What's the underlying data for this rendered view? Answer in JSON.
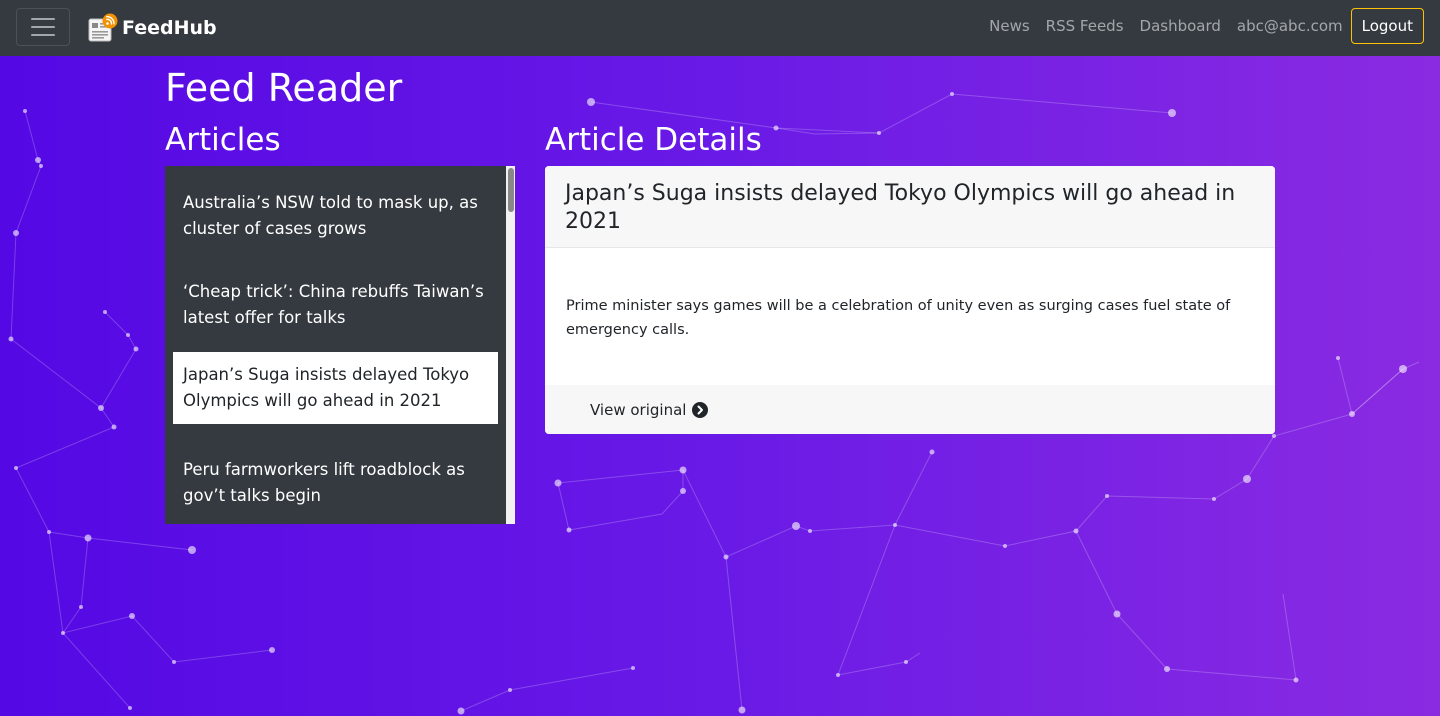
{
  "navbar": {
    "brand": "FeedHub",
    "links": [
      "News",
      "RSS Feeds",
      "Dashboard",
      "abc@abc.com"
    ],
    "logout_label": "Logout",
    "icons": {
      "menu": "hamburger-icon",
      "brand": "rss-newspaper-logo"
    }
  },
  "page": {
    "title": "Feed Reader",
    "articles_heading": "Articles",
    "details_heading": "Article Details"
  },
  "articles": [
    {
      "title": "Australia’s NSW told to mask up, as cluster of cases grows"
    },
    {
      "title": "‘Cheap trick’: China rebuffs Taiwan’s latest offer for talks"
    },
    {
      "title": "Japan’s Suga insists delayed Tokyo Olympics will go ahead in 2021",
      "selected": true
    },
    {
      "title": "Peru farmworkers lift roadblock as gov’t talks begin"
    }
  ],
  "detail": {
    "title": "Japan’s Suga insists delayed Tokyo Olympics will go ahead in 2021",
    "summary": "Prime minister says games will be a celebration of unity even as surging cases fuel state of emergency calls.",
    "view_original_label": "View original",
    "view_original_icon": "chevron-circle-right-icon"
  },
  "colors": {
    "navbar": "#343a40",
    "background_start": "#5408e4",
    "background_end": "#8a2be2",
    "logout_border": "#ffc107",
    "article_list_bg": "#343a40"
  }
}
